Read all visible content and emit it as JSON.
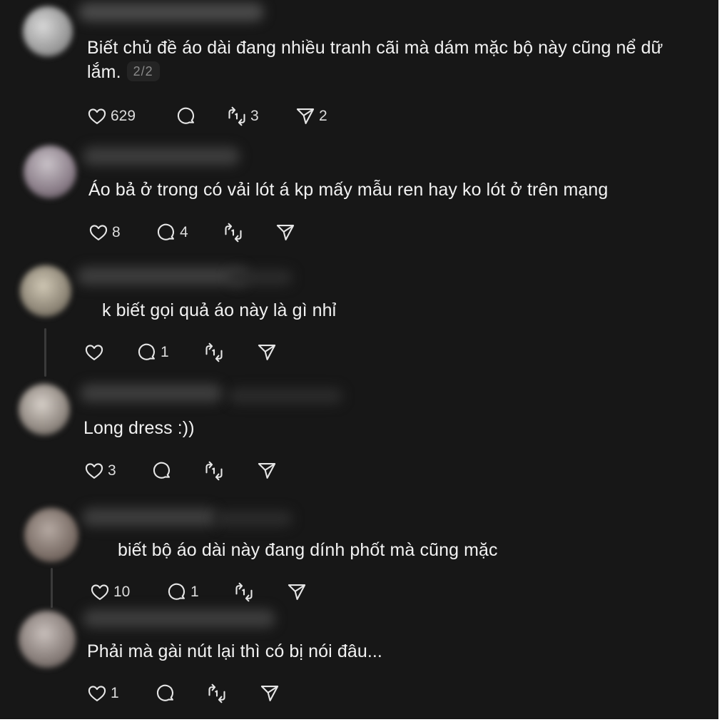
{
  "theme": {
    "background": "#171717",
    "text": "#f2f2f2",
    "icon": "#e6e6e6",
    "muted": "#8a8a8a"
  },
  "icons": {
    "like": "heart-icon",
    "reply": "speech-bubble-icon",
    "repost": "repost-arrows-icon",
    "share": "send-paper-plane-icon"
  },
  "posts": [
    {
      "text_line1": "Biết chủ đề áo dài đang nhiều tranh cãi mà dám mặc bộ này cũng nể dữ",
      "text_line2": "lắm.",
      "pager": "2/2",
      "likes": "629",
      "replies": "",
      "reposts": "3",
      "shares": "2"
    },
    {
      "text": "Áo bả ở trong có vải lót á kp mấy mẫu ren hay ko lót ở trên mạng",
      "likes": "8",
      "replies": "4",
      "reposts": "",
      "shares": ""
    },
    {
      "text": "k biết gọi quả áo này là gì nhỉ",
      "likes": "",
      "replies": "1",
      "reposts": "",
      "shares": ""
    },
    {
      "text": "Long dress :))",
      "likes": "3",
      "replies": "",
      "reposts": "",
      "shares": ""
    },
    {
      "text": "biết bộ áo dài này đang dính phốt mà cũng mặc",
      "likes": "10",
      "replies": "1",
      "reposts": "",
      "shares": ""
    },
    {
      "text": "Phải mà gài nút lại thì có bị nói đâu...",
      "likes": "1",
      "replies": "",
      "reposts": "",
      "shares": ""
    }
  ]
}
